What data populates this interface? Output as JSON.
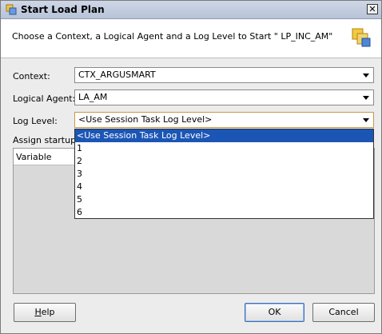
{
  "window": {
    "title": "Start Load Plan",
    "close_label": "✕"
  },
  "header": {
    "instruction": "Choose a Context, a Logical Agent and a Log Level to Start \" LP_INC_AM\""
  },
  "form": {
    "context_label": "Context:",
    "context_value": "CTX_ARGUSMART",
    "agent_label": "Logical Agent:",
    "agent_value": "LA_AM",
    "loglevel_label": "Log Level:",
    "loglevel_value": "<Use Session Task Log Level>",
    "assign_label": "Assign startup v"
  },
  "variables_table": {
    "column_header": "Variable"
  },
  "loglevel_dropdown": {
    "options": [
      "<Use Session Task Log Level>",
      "1",
      "2",
      "3",
      "4",
      "5",
      "6"
    ],
    "selected_index": 0
  },
  "buttons": {
    "help_label_mnemonic": "H",
    "help_label_rest": "elp",
    "ok_label": "OK",
    "cancel_label": "Cancel"
  },
  "icons": {
    "title_icon": "load-plan-icon",
    "header_icon": "load-plan-large-icon",
    "close_icon": "close-icon"
  },
  "colors": {
    "selection": "#1c56b5",
    "titlebar": "#b7c3d8"
  }
}
